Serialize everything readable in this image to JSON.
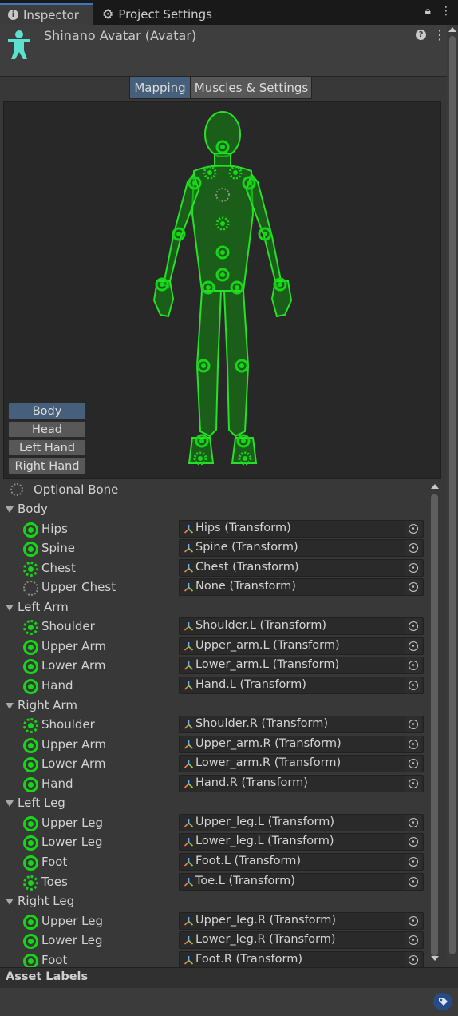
{
  "tabs": {
    "inspector": "Inspector",
    "project_settings": "Project Settings"
  },
  "header": {
    "title": "Shinano Avatar (Avatar)"
  },
  "view_toggle": {
    "mapping": "Mapping",
    "muscles": "Muscles & Settings",
    "selected": "Mapping"
  },
  "body_parts": {
    "buttons": [
      "Body",
      "Head",
      "Left Hand",
      "Right Hand"
    ],
    "selected": "Body"
  },
  "optional_bone_label": "Optional Bone",
  "groups": [
    {
      "name": "Body",
      "bones": [
        {
          "name": "Hips",
          "value": "Hips (Transform)",
          "state": "mapped"
        },
        {
          "name": "Spine",
          "value": "Spine (Transform)",
          "state": "mapped"
        },
        {
          "name": "Chest",
          "value": "Chest (Transform)",
          "state": "optional-mapped"
        },
        {
          "name": "Upper Chest",
          "value": "None (Transform)",
          "state": "optional-empty"
        }
      ]
    },
    {
      "name": "Left Arm",
      "bones": [
        {
          "name": "Shoulder",
          "value": "Shoulder.L (Transform)",
          "state": "optional-mapped"
        },
        {
          "name": "Upper Arm",
          "value": "Upper_arm.L (Transform)",
          "state": "mapped"
        },
        {
          "name": "Lower Arm",
          "value": "Lower_arm.L (Transform)",
          "state": "mapped"
        },
        {
          "name": "Hand",
          "value": "Hand.L (Transform)",
          "state": "mapped"
        }
      ]
    },
    {
      "name": "Right Arm",
      "bones": [
        {
          "name": "Shoulder",
          "value": "Shoulder.R (Transform)",
          "state": "optional-mapped"
        },
        {
          "name": "Upper Arm",
          "value": "Upper_arm.R (Transform)",
          "state": "mapped"
        },
        {
          "name": "Lower Arm",
          "value": "Lower_arm.R (Transform)",
          "state": "mapped"
        },
        {
          "name": "Hand",
          "value": "Hand.R (Transform)",
          "state": "mapped"
        }
      ]
    },
    {
      "name": "Left Leg",
      "bones": [
        {
          "name": "Upper Leg",
          "value": "Upper_leg.L (Transform)",
          "state": "mapped"
        },
        {
          "name": "Lower Leg",
          "value": "Lower_leg.L (Transform)",
          "state": "mapped"
        },
        {
          "name": "Foot",
          "value": "Foot.L (Transform)",
          "state": "mapped"
        },
        {
          "name": "Toes",
          "value": "Toe.L (Transform)",
          "state": "optional-mapped"
        }
      ]
    },
    {
      "name": "Right Leg",
      "bones": [
        {
          "name": "Upper Leg",
          "value": "Upper_leg.R (Transform)",
          "state": "mapped"
        },
        {
          "name": "Lower Leg",
          "value": "Lower_leg.R (Transform)",
          "state": "mapped"
        },
        {
          "name": "Foot",
          "value": "Foot.R (Transform)",
          "state": "mapped"
        }
      ]
    }
  ],
  "asset_labels": "Asset Labels",
  "colors": {
    "mapped_green": "#17d617",
    "selected_blue": "#46607c",
    "active_tab_accent": "#3a79bb"
  },
  "icons": [
    "info-icon",
    "gear-icon",
    "lock-icon",
    "kebab-menu-icon",
    "avatar-icon",
    "help-icon",
    "transform-icon",
    "object-picker-icon",
    "tag-icon"
  ]
}
